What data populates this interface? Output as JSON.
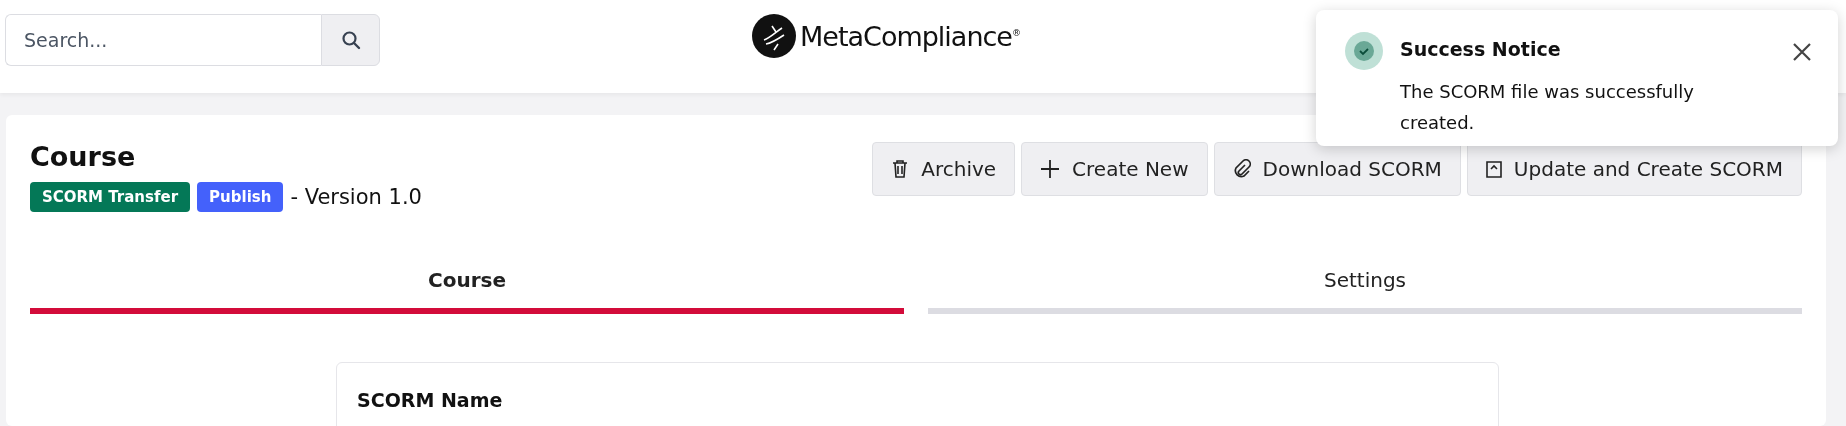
{
  "search": {
    "placeholder": "Search..."
  },
  "logo": {
    "text": "MetaCompliance",
    "mark": "®"
  },
  "toast": {
    "title": "Success Notice",
    "message": "The SCORM file was successfully created."
  },
  "course": {
    "title": "Course",
    "version": "- Version 1.0",
    "badges": [
      {
        "label": "SCORM Transfer",
        "color": "#047857"
      },
      {
        "label": "Publish",
        "color": "#4461fb"
      }
    ],
    "actions": [
      {
        "label": "Archive",
        "kind": "trash"
      },
      {
        "label": "Create New",
        "kind": "plus"
      },
      {
        "label": "Download SCORM",
        "kind": "clip"
      },
      {
        "label": "Update and Create SCORM",
        "kind": "upload"
      }
    ]
  },
  "tabs": [
    {
      "label": "Course",
      "selected": true
    },
    {
      "label": "Settings",
      "selected": false
    }
  ],
  "form": {
    "label": "SCORM Name"
  }
}
